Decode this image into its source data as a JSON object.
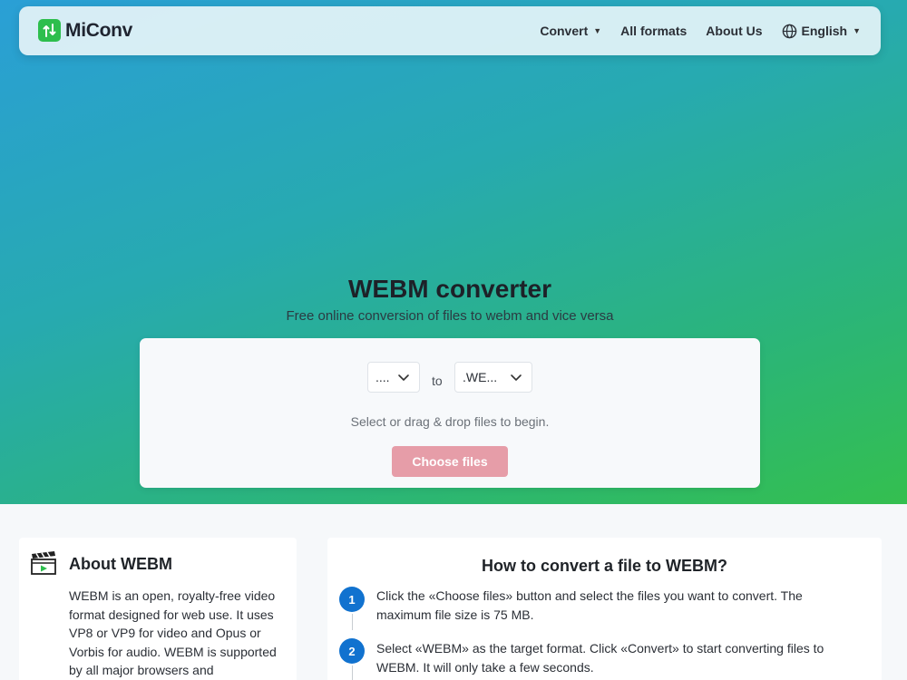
{
  "brand": {
    "name": "MiConv"
  },
  "nav": {
    "convert": "Convert",
    "all_formats": "All formats",
    "about_us": "About Us",
    "language": "English"
  },
  "hero": {
    "title": "WEBM converter",
    "subtitle": "Free online conversion of files to webm and vice versa"
  },
  "converter": {
    "from_value": "....",
    "to_label": "to",
    "to_value": ".WE...",
    "hint": "Select or drag & drop files to begin.",
    "choose_button": "Choose files"
  },
  "about": {
    "title": "About WEBM",
    "text": "WEBM is an open, royalty-free video format designed for web use. It uses VP8 or VP9 for video and Opus or Vorbis for audio. WEBM is supported by all major browsers and"
  },
  "howto": {
    "title": "How to convert a file to WEBM?",
    "steps": [
      {
        "num": "1",
        "text": "Click the «Choose files» button and select the files you want to convert. The maximum file size is 75 MB."
      },
      {
        "num": "2",
        "text": "Select «WEBM» as the target format. Click «Convert» to start converting files to WEBM. It will only take a few seconds."
      }
    ]
  },
  "colors": {
    "accent_green": "#2dbe4d",
    "button_pink": "#e69da8",
    "step_blue": "#1172cf"
  },
  "icons": [
    "logo-icon",
    "caret-down-icon",
    "globe-icon",
    "chevron-down-icon",
    "clapperboard-icon"
  ]
}
